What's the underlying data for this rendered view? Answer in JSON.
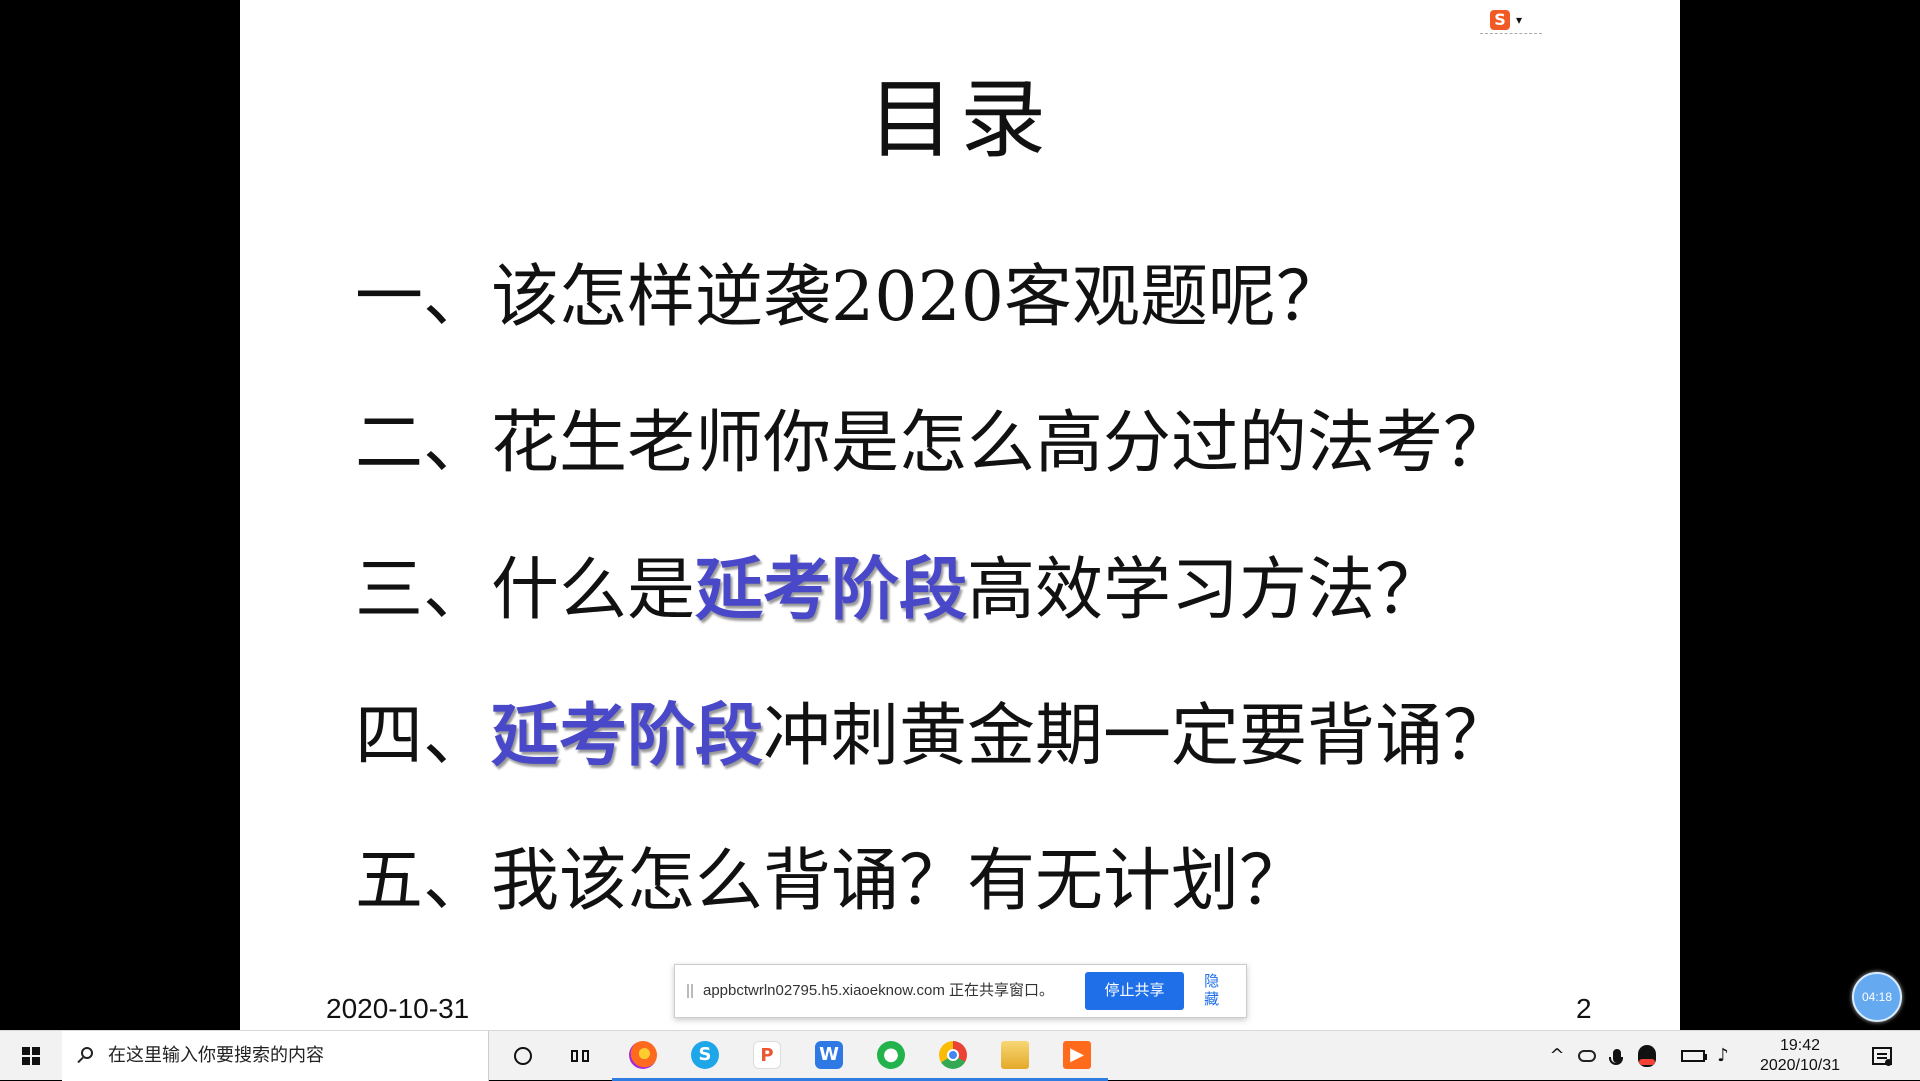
{
  "ime": {
    "logo": "S",
    "caret": "▾"
  },
  "slide": {
    "title": "目录",
    "items": [
      {
        "prefix": "一、该怎样逆袭2020客观题呢？",
        "highlight": "",
        "suffix": ""
      },
      {
        "prefix": "二、花生老师你是怎么高分过的法考？",
        "highlight": "",
        "suffix": ""
      },
      {
        "prefix": "三、什么是",
        "highlight": "延考阶段",
        "suffix": "高效学习方法？"
      },
      {
        "prefix": "四、",
        "highlight": "延考阶段",
        "suffix": "冲刺黄金期一定要背诵？"
      },
      {
        "prefix": "五、我该怎么背诵？有无计划？",
        "highlight": "",
        "suffix": ""
      }
    ],
    "date": "2020-10-31",
    "page_number": "2"
  },
  "share_bar": {
    "text": "appbctwrln02795.h5.xiaoeknow.com 正在共享窗口。",
    "stop_button": "停止共享",
    "hide_link": "隐藏"
  },
  "timer": {
    "value": "04:18"
  },
  "taskbar": {
    "search_placeholder": "在这里输入你要搜索的内容",
    "apps": [
      {
        "name": "firefox-icon",
        "label": ""
      },
      {
        "name": "sogou-browser-icon",
        "label": "S"
      },
      {
        "name": "wps-pdf-icon",
        "label": "P"
      },
      {
        "name": "wps-writer-icon",
        "label": "W"
      },
      {
        "name": "wechat-icon",
        "label": "●"
      },
      {
        "name": "chrome-icon",
        "label": ""
      },
      {
        "name": "file-explorer-icon",
        "label": ""
      },
      {
        "name": "media-player-icon",
        "label": "▶"
      }
    ],
    "clock": {
      "time": "19:42",
      "date": "2020/10/31"
    }
  }
}
